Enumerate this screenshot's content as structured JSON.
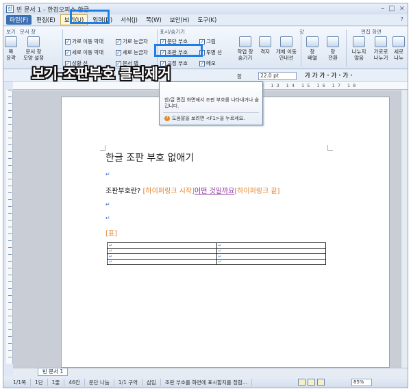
{
  "window": {
    "title": "빈 문서 1 - 한컴오피스 한글"
  },
  "menu": {
    "items": [
      "파일(F)",
      "편집(E)",
      "보기(U)",
      "입력(D)",
      "서식(J)",
      "쪽(W)",
      "보안(H)",
      "도구(K)"
    ],
    "right": "?"
  },
  "ribbon": {
    "groups": {
      "view": "보기",
      "doc_window": "문서 창",
      "show_hide": "표시/숨기기",
      "window": "창",
      "edit_screen": "편집 화면"
    },
    "buttons": {
      "zoom": "쪽\n윤곽",
      "doc_window_settings": "문서 창\n모양 설정",
      "work_window": "작업 창\n숨기기",
      "grid": "격자",
      "object_move": "개체 이동\n안내선",
      "arrange": "창\n배열",
      "switch": "창\n전환",
      "split": "나누지\n않음",
      "split_h": "가로로\n나누기",
      "split_v": "세로\n나누"
    },
    "checks": {
      "h_scroll": "가로 이동 막대",
      "h_ruler": "가로 눈금자",
      "v_scroll": "세로 이동 막대",
      "v_ruler": "세로 눈금자",
      "status": "상황 선",
      "doc_tab": "문서 탭",
      "text_frame": "문단 부호",
      "control_code": "조판 부호",
      "memo_icon": "메모",
      "picture": "그림",
      "transparent_line": "투명 선",
      "frame": "교정 부호"
    }
  },
  "format_toolbar": {
    "font": "함",
    "size": "22.0",
    "unit": "pt",
    "styles": "가 가 가 · 가 · 가 ·"
  },
  "caption": "보기-조판부호 클릭제거",
  "ruler": {
    "numbers": "12 13 14 15 16 17 18"
  },
  "tooltip": {
    "body": "한/글 편집 화면에서 조판 부호를 나타내거나 숨깁니다.",
    "help": "도움말을 보려면 <F1>을 누르세요."
  },
  "document": {
    "title": "한글 조판 부호 없애기",
    "line1_prefix": "조판부호란?",
    "hyperlink_start": "[하이퍼링크 시작]",
    "link_text": "어떤 것일까요",
    "hyperlink_end": "[하이퍼링크 끝]",
    "table_label": "[표]"
  },
  "doc_tab": "빈 문서 1",
  "status": {
    "page": "1/1쪽",
    "section": "1단",
    "line": "1줄",
    "column": "46칸",
    "char": "문단 나눔",
    "area": "1/1 구역",
    "mode": "삽입",
    "message": "조판 부호를 화면에 표시할지를 정합...",
    "zoom": "85%"
  }
}
